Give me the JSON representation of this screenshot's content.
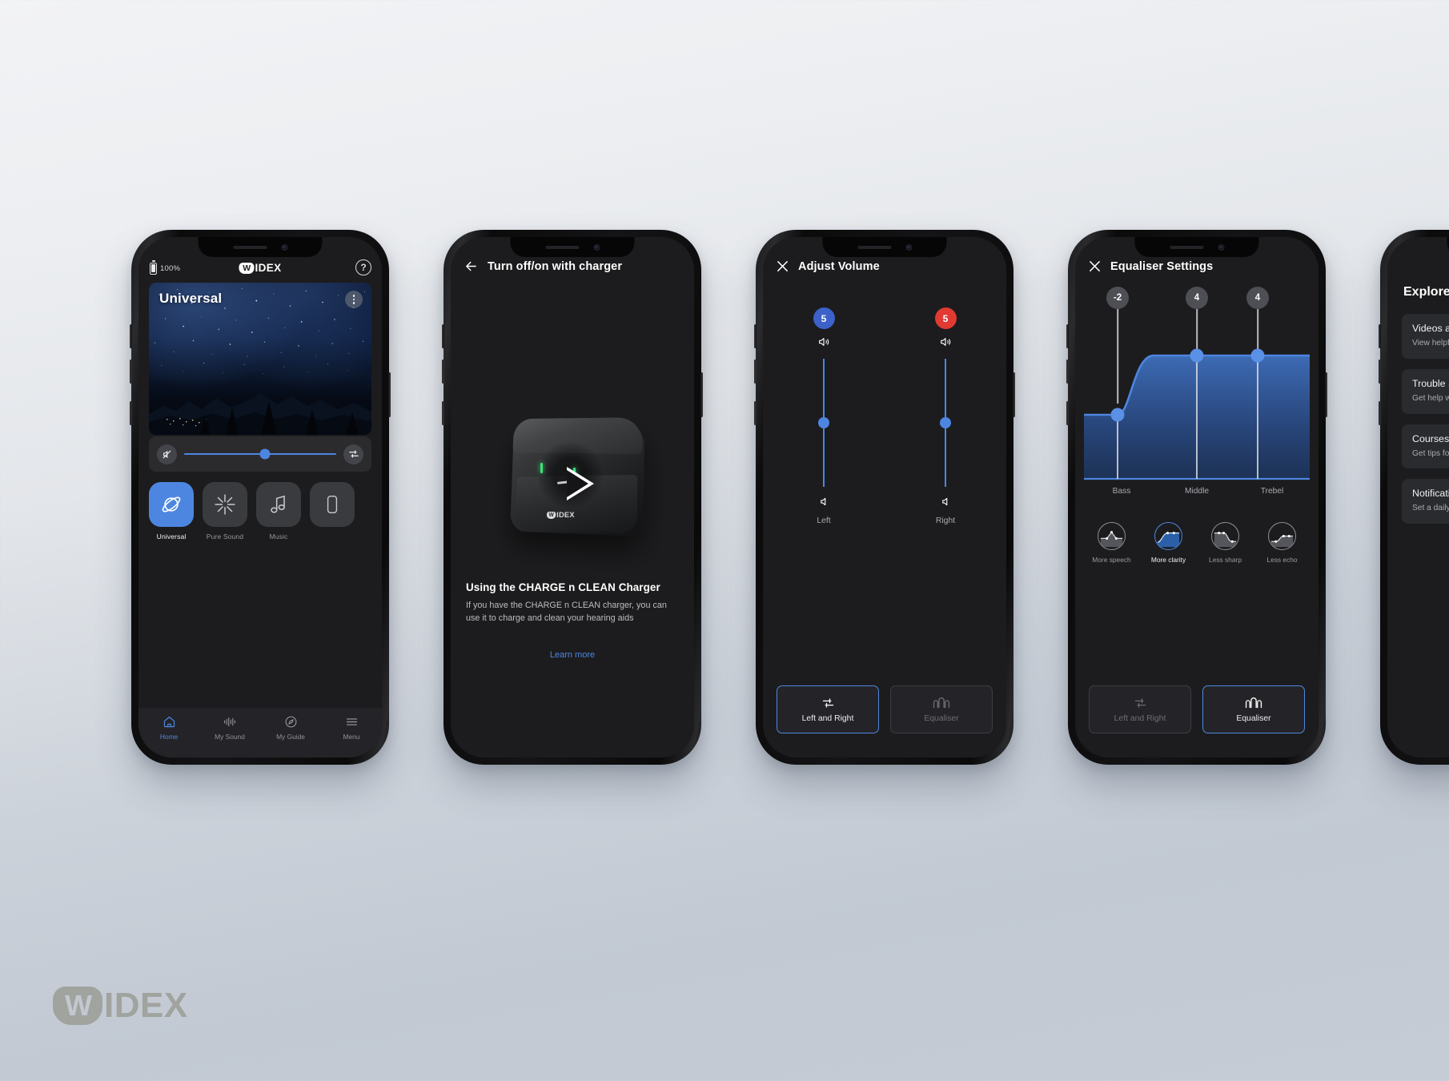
{
  "brand": {
    "name": "WIDEX",
    "w_letter": "W",
    "rest": "IDEX"
  },
  "phone1": {
    "battery": "100%",
    "help_icon": "question-mark-icon",
    "program_title": "Universal",
    "menu_icon": "kebab-menu-icon",
    "mute_icon": "mute-icon",
    "eq_icon": "equalizer-icon",
    "slider_value": 53,
    "programs": [
      {
        "label": "Universal",
        "icon": "planet-icon",
        "selected": true
      },
      {
        "label": "Pure Sound",
        "icon": "starburst-icon",
        "selected": false
      },
      {
        "label": "Music",
        "icon": "music-note-icon",
        "selected": false
      },
      {
        "label": "",
        "icon": "phone-icon",
        "selected": false
      }
    ],
    "nav": [
      {
        "label": "Home",
        "icon": "home-icon",
        "active": true
      },
      {
        "label": "My Sound",
        "icon": "sound-bars-icon",
        "active": false
      },
      {
        "label": "My Guide",
        "icon": "compass-icon",
        "active": false
      },
      {
        "label": "Menu",
        "icon": "hamburger-icon",
        "active": false
      }
    ]
  },
  "phone2": {
    "back_icon": "back-arrow-icon",
    "title": "Turn off/on with charger",
    "play_icon": "play-icon",
    "device_brand": "WIDEX",
    "heading": "Using the CHARGE n CLEAN Charger",
    "body": "If you have the CHARGE n CLEAN charger, you can use it to charge and clean your hearing aids",
    "link": "Learn more"
  },
  "phone3": {
    "close_icon": "close-icon",
    "title": "Adjust Volume",
    "channels": [
      {
        "label": "Left",
        "value": "5",
        "badge_color": "#3c62c9",
        "slider_pos": 50
      },
      {
        "label": "Right",
        "value": "5",
        "badge_color": "#e03a33",
        "slider_pos": 50
      }
    ],
    "volume_up_icon": "volume-high-icon",
    "volume_down_icon": "volume-low-icon",
    "buttons": [
      {
        "label": "Left and Right",
        "icon": "sliders-icon",
        "selected": true
      },
      {
        "label": "Equaliser",
        "icon": "eq-curve-icon",
        "selected": false
      }
    ]
  },
  "phone4": {
    "close_icon": "close-icon",
    "title": "Equaliser Settings",
    "bands": [
      {
        "label": "Bass",
        "value": "-2"
      },
      {
        "label": "Middle",
        "value": "4"
      },
      {
        "label": "Trebel",
        "value": "4"
      }
    ],
    "presets": [
      {
        "label": "More speech",
        "icon": "preset-peak-icon",
        "selected": false
      },
      {
        "label": "More clarity",
        "icon": "preset-rising-icon",
        "selected": true
      },
      {
        "label": "Less sharp",
        "icon": "preset-falling-icon",
        "selected": false
      },
      {
        "label": "Less echo",
        "icon": "preset-step-icon",
        "selected": false
      }
    ],
    "buttons": [
      {
        "label": "Left and Right",
        "icon": "sliders-icon",
        "selected": false
      },
      {
        "label": "Equaliser",
        "icon": "eq-curve-icon",
        "selected": true
      }
    ]
  },
  "phone5": {
    "heading": "Explore",
    "cards": [
      {
        "title": "Videos a",
        "desc": "View helpf instruction"
      },
      {
        "title": "Trouble S",
        "desc": "Get help w sound qua fit of your"
      },
      {
        "title": "Courses",
        "desc": "Get tips fo hearing aid more abou hearing."
      },
      {
        "title": "Notificati",
        "desc": "Set a daily on your he"
      }
    ]
  },
  "chart_data": {
    "type": "line",
    "title": "Equaliser Settings",
    "categories": [
      "Bass",
      "Middle",
      "Trebel"
    ],
    "values": [
      -2,
      4,
      4
    ],
    "ylim": [
      -10,
      10
    ],
    "xlabel": "",
    "ylabel": "",
    "grid": false,
    "series": [
      {
        "name": "Equaliser",
        "values": [
          -2,
          4,
          4
        ]
      }
    ]
  },
  "colors": {
    "accent": "#4d86e0",
    "left": "#3c62c9",
    "right": "#e03a33",
    "screen_bg": "#1c1c1e",
    "card_bg": "#2b2b2e",
    "muted_text": "#a9aab0"
  }
}
